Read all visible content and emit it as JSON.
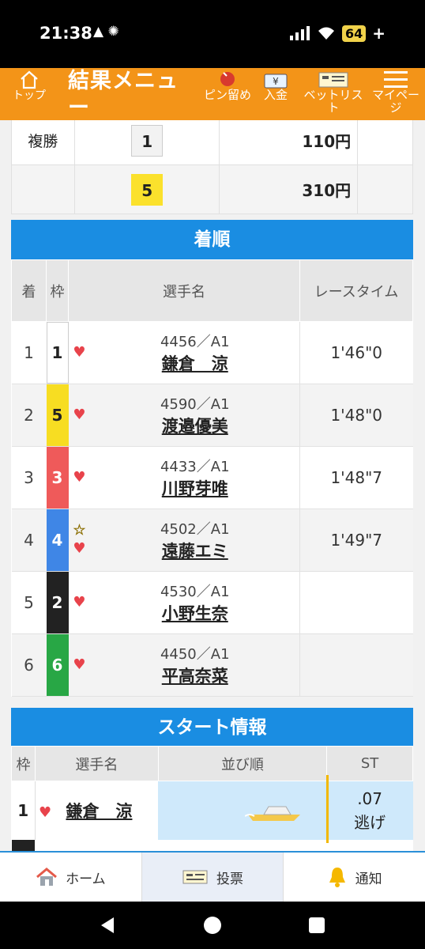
{
  "status_bar": {
    "time": "21:38",
    "battery": "64",
    "battery_suffix": "+"
  },
  "header": {
    "home_label": "トップ",
    "title": "結果メニュー",
    "nav": [
      {
        "icon": "pin-icon",
        "label": "ピン留め"
      },
      {
        "icon": "yen-icon",
        "label": "入金"
      },
      {
        "icon": "ticket-icon",
        "label": "ベットリスト"
      },
      {
        "icon": "menu-icon",
        "label": "マイページ"
      }
    ]
  },
  "payouts": [
    {
      "type": "複勝",
      "number": "1",
      "amount": "110円",
      "highlight": false
    },
    {
      "type": "",
      "number": "5",
      "amount": "310円",
      "highlight": true
    }
  ],
  "results_section": {
    "title": "着順",
    "headers": {
      "order": "着",
      "frame": "枠",
      "name": "選手名",
      "time": "レースタイム"
    },
    "rows": [
      {
        "order": "1",
        "frame": "1",
        "id": "4456／A1",
        "name": "鎌倉　涼",
        "time": "1'46\"0",
        "star": false
      },
      {
        "order": "2",
        "frame": "5",
        "id": "4590／A1",
        "name": "渡邉優美",
        "time": "1'48\"0",
        "star": false
      },
      {
        "order": "3",
        "frame": "3",
        "id": "4433／A1",
        "name": "川野芽唯",
        "time": "1'48\"7",
        "star": false
      },
      {
        "order": "4",
        "frame": "4",
        "id": "4502／A1",
        "name": "遠藤エミ",
        "time": "1'49\"7",
        "star": true
      },
      {
        "order": "5",
        "frame": "2",
        "id": "4530／A1",
        "name": "小野生奈",
        "time": "",
        "star": false
      },
      {
        "order": "6",
        "frame": "6",
        "id": "4450／A1",
        "name": "平高奈菜",
        "time": "",
        "star": false
      }
    ],
    "frame_colors": {
      "1": "#ffffff",
      "2": "#222222",
      "3": "#ef5a5a",
      "4": "#3f86e6",
      "5": "#f7dd22",
      "6": "#28a745"
    },
    "frame_text_colors": {
      "1": "#222222",
      "2": "#ffffff",
      "3": "#ffffff",
      "4": "#ffffff",
      "5": "#222222",
      "6": "#ffffff"
    }
  },
  "start_section": {
    "title": "スタート情報",
    "headers": {
      "frame": "枠",
      "name": "選手名",
      "order": "並び順",
      "st": "ST"
    },
    "rows": [
      {
        "frame": "1",
        "name": "鎌倉　涼",
        "st": ".07",
        "note": "逃げ"
      }
    ]
  },
  "bottom_nav": [
    {
      "icon": "home-icon",
      "label": "ホーム",
      "active": false
    },
    {
      "icon": "vote-icon",
      "label": "投票",
      "active": true
    },
    {
      "icon": "bell-icon",
      "label": "通知",
      "active": false
    }
  ],
  "colors": {
    "header_orange": "#f39418",
    "section_blue": "#1a8de2",
    "heart": "#e8434b",
    "star": "#f5c400"
  }
}
